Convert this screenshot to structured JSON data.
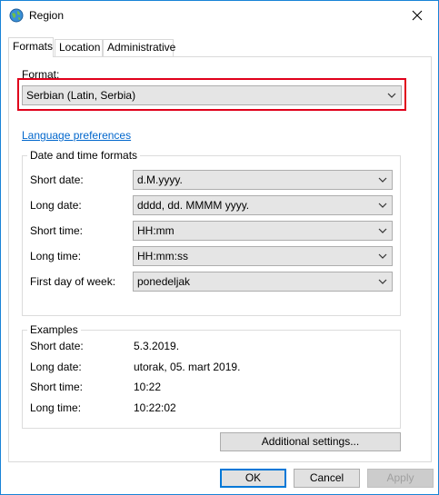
{
  "window": {
    "title": "Region"
  },
  "icons": {
    "title": "region-globe-icon",
    "close": "close-icon",
    "dropdown": "chevron-down-icon"
  },
  "tabs": [
    {
      "label": "Formats",
      "active": true
    },
    {
      "label": "Location",
      "active": false
    },
    {
      "label": "Administrative",
      "active": false
    }
  ],
  "format": {
    "label": "Format:",
    "value": "Serbian (Latin, Serbia)"
  },
  "language_link": "Language preferences",
  "date_time_formats": {
    "title": "Date and time formats",
    "rows": [
      {
        "label": "Short date:",
        "value": "d.M.yyyy."
      },
      {
        "label": "Long date:",
        "value": "dddd, dd. MMMM yyyy."
      },
      {
        "label": "Short time:",
        "value": "HH:mm"
      },
      {
        "label": "Long time:",
        "value": "HH:mm:ss"
      },
      {
        "label": "First day of week:",
        "value": "ponedeljak"
      }
    ]
  },
  "examples": {
    "title": "Examples",
    "rows": [
      {
        "label": "Short date:",
        "value": "5.3.2019."
      },
      {
        "label": "Long date:",
        "value": "utorak, 05. mart 2019."
      },
      {
        "label": "Short time:",
        "value": "10:22"
      },
      {
        "label": "Long time:",
        "value": "10:22:02"
      }
    ]
  },
  "buttons": {
    "additional": "Additional settings...",
    "ok": "OK",
    "cancel": "Cancel",
    "apply": "Apply"
  },
  "colors": {
    "accent": "#0078d7",
    "link": "#0066cc",
    "highlight": "#e0001b"
  }
}
